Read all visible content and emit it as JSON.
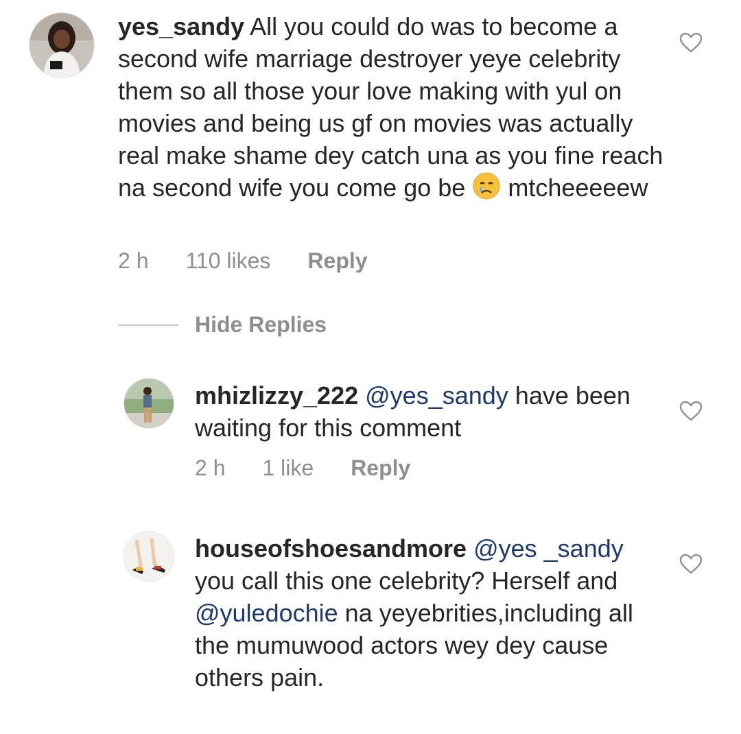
{
  "comments": [
    {
      "username": "yes_sandy",
      "body_parts": [
        " All you could do was to become a second wife marriage destroyer  yeye celebrity them so all those your love making with yul on movies and being us gf on movies was actually real make shame dey catch una as you fine reach na second wife you come go be ",
        " mtcheeeeew"
      ],
      "emoji": "crying-face-emoji",
      "time": "2 h",
      "likes": "110 likes",
      "reply": "Reply"
    }
  ],
  "hide_replies": "Hide Replies",
  "replies": [
    {
      "username": "mhizlizzy_222",
      "mention": "@yes_sandy",
      "body": " have been waiting for this comment",
      "time": "2 h",
      "likes": "1 like",
      "reply": "Reply"
    },
    {
      "username": "houseofshoesandmore",
      "mention1": "@yes _sandy",
      "body1": "  you call this one celebrity? Herself and ",
      "mention2": "@yuledochie",
      "body2": " na yeyebrities,including all the mumuwood actors wey dey cause others pain."
    }
  ],
  "icons": {
    "heart": "heart-outline-icon"
  },
  "colors": {
    "text": "#262626",
    "meta": "#8e8e8e",
    "mention": "#1e3a6b"
  }
}
